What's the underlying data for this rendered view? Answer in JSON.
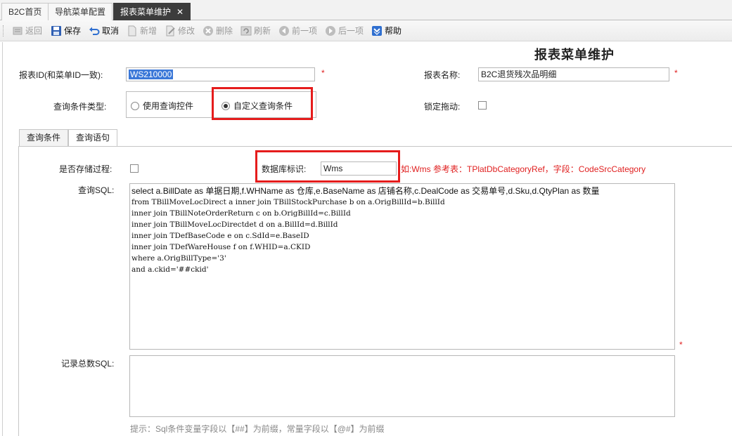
{
  "tabs": [
    {
      "label": "B2C首页"
    },
    {
      "label": "导航菜单配置"
    },
    {
      "label": "报表菜单维护",
      "close": "✕"
    }
  ],
  "toolbar": {
    "back": "返回",
    "save": "保存",
    "cancel": "取消",
    "add": "新增",
    "edit": "修改",
    "delete": "删除",
    "refresh": "刷新",
    "prev": "前一项",
    "next": "后一项",
    "help": "帮助"
  },
  "form": {
    "title": "报表菜单维护",
    "report_id_label": "报表ID(和菜单ID一致):",
    "report_id_value": "WS210000",
    "report_name_label": "报表名称:",
    "report_name_value": "B2C退货残次品明细",
    "required_mark": "*",
    "query_type_label": "查询条件类型:",
    "query_type_options": [
      "使用查询控件",
      "自定义查询条件"
    ],
    "query_type_selected": "自定义查询条件",
    "lock_drag_label": "锁定拖动:",
    "lock_drag_checked": false
  },
  "inner_tabs": [
    "查询条件",
    "查询语句"
  ],
  "inner_tab_active": "查询语句",
  "query_panel": {
    "stored_proc_label": "是否存储过程:",
    "stored_proc_checked": false,
    "db_tag_label": "数据库标识:",
    "db_tag_value": "Wms",
    "db_tag_hint": "如:Wms 参考表：TPlatDbCategoryRef，字段：CodeSrcCategory",
    "sql_label": "查询SQL:",
    "sql_lines": [
      "select a.BillDate as 单据日期,f.WHName as 仓库,e.BaseName as 店铺名称,c.DealCode as 交易单号,d.Sku,d.QtyPlan as 数量",
      "from TBillMoveLocDirect a inner join TBillStockPurchase b on a.OrigBillId=b.BillId",
      "inner join TBillNoteOrderReturn c on b.OrigBillId=c.BillId",
      "inner join TBillMoveLocDirectdet d on a.BillId=d.BillId",
      "inner join TDefBaseCode e on c.SdId=e.BaseID",
      "inner join TDefWareHouse f on f.WHID=a.CKID",
      "where a.OrigBillType='3'",
      "and a.ckid='##ckid'"
    ],
    "count_sql_label": "记录总数SQL:",
    "count_sql_value": "",
    "tip": "提示：Sql条件变量字段以【##】为前缀，常量字段以【@#】为前缀"
  },
  "colors": {
    "highlight": "#e51c1c",
    "active_tab_bg": "#3c3c3c",
    "selection": "#3b78d8"
  }
}
